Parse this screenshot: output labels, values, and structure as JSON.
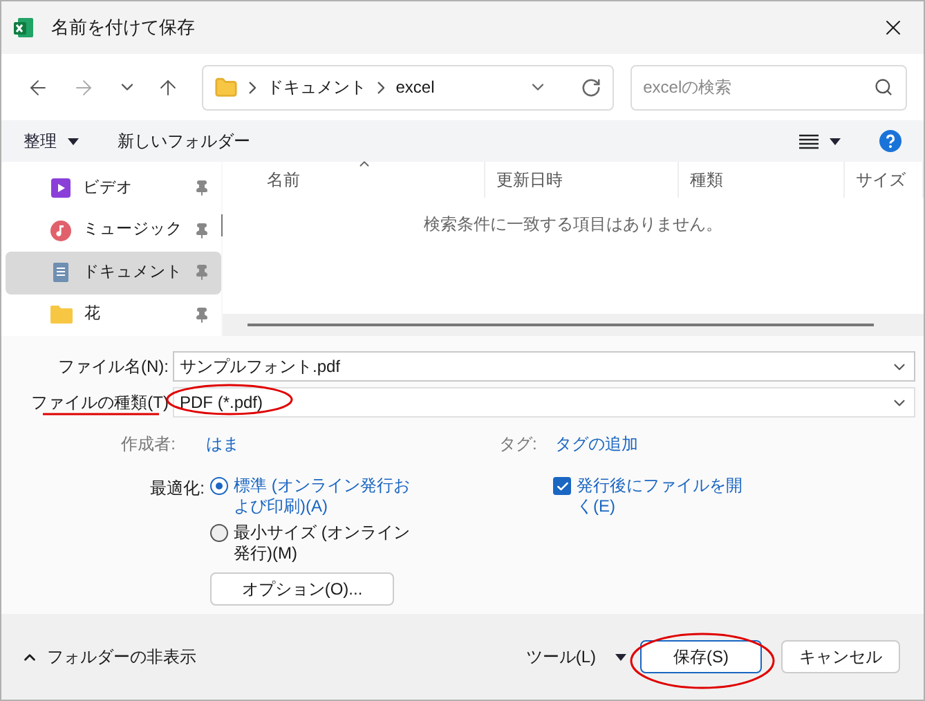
{
  "window": {
    "title": "名前を付けて保存"
  },
  "address_bar": {
    "segments": [
      "ドキュメント",
      "excel"
    ]
  },
  "search": {
    "placeholder": "excelの検索"
  },
  "toolbar": {
    "organize": "整理",
    "new_folder": "新しいフォルダー"
  },
  "sidebar": {
    "items": [
      {
        "label": "ビデオ",
        "kind": "video",
        "selected": false
      },
      {
        "label": "ミュージック",
        "kind": "music",
        "selected": false
      },
      {
        "label": "ドキュメント",
        "kind": "document",
        "selected": true
      },
      {
        "label": "花",
        "kind": "folder",
        "selected": false
      }
    ]
  },
  "table": {
    "columns": [
      "名前",
      "更新日時",
      "種類",
      "サイズ"
    ],
    "empty_message": "検索条件に一致する項目はありません。"
  },
  "form": {
    "file_name_label": "ファイル名(N):",
    "file_name": "サンプルフォント.pdf",
    "file_type_label": "ファイルの種類(T)",
    "file_type": "PDF (*.pdf)",
    "author_label": "作成者:",
    "author": "はま",
    "tags_label": "タグ:",
    "tags": "タグの追加",
    "optimize_label": "最適化:",
    "optimize_options": [
      {
        "label": "標準 (オンライン発行および印刷)(A)",
        "selected": true
      },
      {
        "label": "最小サイズ (オンライン発行)(M)",
        "selected": false
      }
    ],
    "open_after": {
      "label": "発行後にファイルを開く(E)",
      "checked": true
    },
    "options_button": "オプション(O)..."
  },
  "footer": {
    "hide_folders": "フォルダーの非表示",
    "tools": "ツール(L)",
    "save": "保存(S)",
    "cancel": "キャンセル"
  }
}
